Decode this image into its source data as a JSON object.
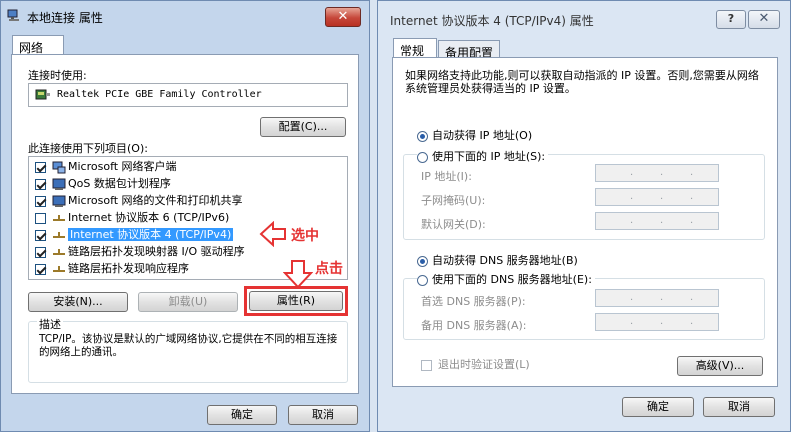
{
  "left_window": {
    "title": "本地连接 属性",
    "close_label": "✕",
    "tab": "网络",
    "connect_using_label": "连接时使用:",
    "adapter_name": "Realtek PCIe GBE Family Controller",
    "configure_button": "配置(C)...",
    "items_label": "此连接使用下列项目(O):",
    "items": [
      {
        "label": "Microsoft 网络客户端",
        "checked": true
      },
      {
        "label": "QoS 数据包计划程序",
        "checked": true
      },
      {
        "label": "Microsoft 网络的文件和打印机共享",
        "checked": true
      },
      {
        "label": "Internet 协议版本 6 (TCP/IPv6)",
        "checked": false
      },
      {
        "label": "Internet 协议版本 4 (TCP/IPv4)",
        "checked": true
      },
      {
        "label": "链路层拓扑发现映射器 I/O 驱动程序",
        "checked": true
      },
      {
        "label": "链路层拓扑发现响应程序",
        "checked": true
      }
    ],
    "install_button": "安装(N)...",
    "uninstall_button": "卸载(U)",
    "properties_button": "属性(R)",
    "description_title": "描述",
    "description_text": "TCP/IP。该协议是默认的广域网络协议,它提供在不同的相互连接的网络上的通讯。",
    "ok_button": "确定",
    "cancel_button": "取消",
    "annotation_select": "选中",
    "annotation_click": "点击"
  },
  "right_window": {
    "title": "Internet 协议版本 4 (TCP/IPv4) 属性",
    "help_label": "?",
    "close_label": "✕",
    "tabs": [
      "常规",
      "备用配置"
    ],
    "intro_text": "如果网络支持此功能,则可以获取自动指派的 IP 设置。否则,您需要从网络系统管理员处获得适当的 IP 设置。",
    "auto_ip": "自动获得 IP 地址(O)",
    "manual_ip": "使用下面的 IP 地址(S):",
    "ip_address_label": "IP 地址(I):",
    "subnet_label": "子网掩码(U):",
    "gateway_label": "默认网关(D):",
    "auto_dns": "自动获得 DNS 服务器地址(B)",
    "manual_dns": "使用下面的 DNS 服务器地址(E):",
    "preferred_dns_label": "首选 DNS 服务器(P):",
    "alternate_dns_label": "备用 DNS 服务器(A):",
    "validate_label": "退出时验证设置(L)",
    "advanced_button": "高级(V)...",
    "ok_button": "确定",
    "cancel_button": "取消"
  },
  "colors": {
    "selection": "#3399ff",
    "annotation": "#e53333"
  }
}
